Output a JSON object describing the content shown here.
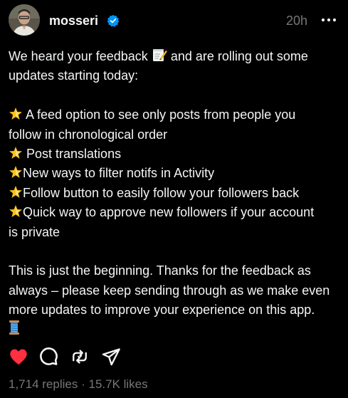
{
  "post": {
    "author": {
      "username": "mosseri",
      "verified": true,
      "avatar_icon": "profile-photo"
    },
    "timestamp": "20h",
    "more_icon": "more-horizontal-icon",
    "body": {
      "intro_line1_a": "We heard your feedback",
      "intro_line1_b": "and are rolling out some",
      "intro_line2": "updates starting today:",
      "items": [
        {
          "text_line1": "A feed option to see only posts from people you",
          "text_line2": "follow in chronological order"
        },
        {
          "text_line1": "Post translations"
        },
        {
          "text_line1": "New ways to filter notifs in Activity"
        },
        {
          "text_line1": "Follow button to easily follow your followers back"
        },
        {
          "text_line1": "Quick way to approve new followers if your account",
          "text_line2": "is private"
        }
      ],
      "outro_line1": "This is just the beginning. Thanks for the feedback as",
      "outro_line2": "always – please keep sending through as we make even",
      "outro_line3": "more updates to improve your experience on this app.",
      "bullet_emoji": "star-glowing",
      "intro_emoji": "memo",
      "outro_emoji": "thread-spool"
    },
    "actions": {
      "like_icon": "heart-filled-icon",
      "reply_icon": "comment-bubble-icon",
      "repost_icon": "repost-icon",
      "share_icon": "send-icon",
      "liked": true
    },
    "stats": {
      "replies": "1,714 replies",
      "separator": "·",
      "likes": "15.7K likes"
    },
    "colors": {
      "background": "#000000",
      "text": "#f3f5f7",
      "muted": "#777777",
      "verified": "#0095f6",
      "like": "#ff3040"
    }
  }
}
